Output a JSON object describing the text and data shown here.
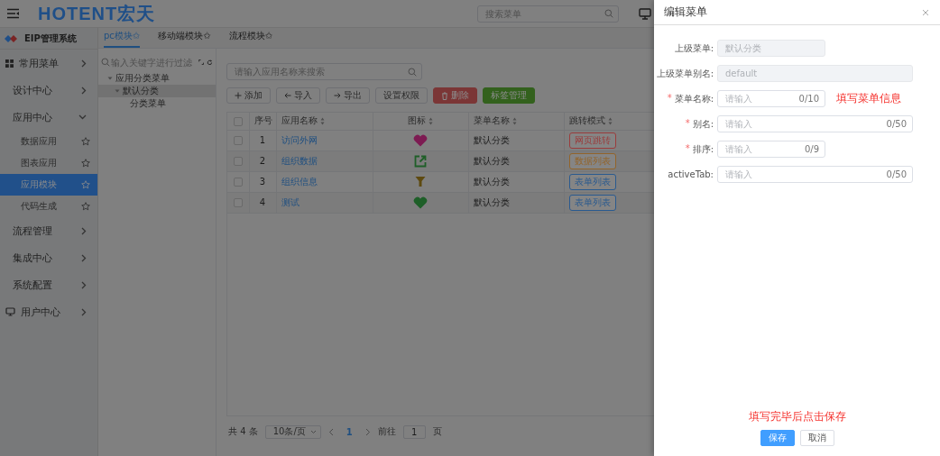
{
  "header": {
    "logo": "HOTENT宏天",
    "search": {
      "placeholder": "搜索菜单"
    }
  },
  "sidebar": {
    "title": "EIP管理系统",
    "items": [
      {
        "label": "常用菜单",
        "kind": "grid",
        "expanded": false
      },
      {
        "label": "设计中心",
        "kind": "plain",
        "expanded": false
      },
      {
        "label": "应用中心",
        "kind": "plain",
        "expanded": true,
        "children": [
          {
            "label": "数据应用",
            "selected": false
          },
          {
            "label": "图表应用",
            "selected": false
          },
          {
            "label": "应用模块",
            "selected": true
          },
          {
            "label": "代码生成",
            "selected": false
          }
        ]
      },
      {
        "label": "流程管理",
        "kind": "plain",
        "expanded": false
      },
      {
        "label": "集成中心",
        "kind": "plain",
        "expanded": false
      },
      {
        "label": "系统配置",
        "kind": "plain",
        "expanded": false
      },
      {
        "label": "用户中心",
        "kind": "monitor",
        "expanded": false
      }
    ]
  },
  "tabs": [
    {
      "label": "pc模块✩",
      "selected": true
    },
    {
      "label": "移动端模块✩",
      "selected": false
    },
    {
      "label": "流程模块✩",
      "selected": false
    }
  ],
  "tree": {
    "filter": {
      "placeholder": "输入关键字进行过滤"
    },
    "nodes": [
      {
        "label": "应用分类菜单",
        "selected": false,
        "expanded": true,
        "children": [
          {
            "label": "默认分类",
            "selected": true,
            "expanded": true,
            "children": [
              {
                "label": "分类菜单",
                "selected": false
              }
            ]
          }
        ]
      }
    ]
  },
  "search": {
    "placeholder": "请输入应用名称来搜索"
  },
  "toolbar": [
    {
      "label": "添加",
      "kind": "add"
    },
    {
      "label": "导入",
      "kind": "import"
    },
    {
      "label": "导出",
      "kind": "export"
    },
    {
      "label": "设置权限",
      "kind": "plain"
    },
    {
      "label": "删除",
      "kind": "danger"
    },
    {
      "label": "标签管理",
      "kind": "success"
    }
  ],
  "table": {
    "select_all": {
      "checked": false
    },
    "columns": [
      {
        "label": "序号",
        "sortable": false
      },
      {
        "label": "应用名称",
        "sortable": true
      },
      {
        "label": "图标",
        "sortable": true
      },
      {
        "label": "菜单名称",
        "sortable": true
      },
      {
        "label": "跳转模式",
        "sortable": true
      }
    ],
    "rows": [
      {
        "checked": false,
        "index": "1",
        "name": "访问外网",
        "icon": {
          "kind": "heart",
          "color": "#7d1b52"
        },
        "menu": "默认分类",
        "mode": {
          "label": "网页跳转",
          "color": "#9a3c3c"
        }
      },
      {
        "checked": false,
        "index": "2",
        "name": "组织数据",
        "icon": {
          "kind": "link",
          "color": "#1f5f28"
        },
        "menu": "默认分类",
        "mode": {
          "label": "数据列表",
          "color": "#93642a"
        }
      },
      {
        "checked": false,
        "index": "3",
        "name": "组织信息",
        "icon": {
          "kind": "filter",
          "color": "#5e4a10"
        },
        "menu": "默认分类",
        "mode": {
          "label": "表单列表",
          "color": "#2a5a8f"
        }
      },
      {
        "checked": false,
        "index": "4",
        "name": "测试",
        "icon": {
          "kind": "heart",
          "color": "#1e5f28"
        },
        "menu": "默认分类",
        "mode": {
          "label": "表单列表",
          "color": "#2a5a8f"
        }
      }
    ]
  },
  "pagination": {
    "total": "共 4 条",
    "page_size": "10条/页",
    "pages": [
      {
        "label": "1",
        "selected": true
      }
    ],
    "goto_label": "前往",
    "goto_value": "1",
    "suffix": "页"
  },
  "drawer": {
    "title": "编辑菜单",
    "fields": [
      {
        "label": "上级菜单:",
        "value": "默认分类",
        "disabled": true,
        "wide": false
      },
      {
        "label": "上级菜单别名:",
        "value": "default",
        "disabled": true,
        "wide": true
      },
      {
        "label": "菜单名称:",
        "required_mark": "*",
        "placeholder": "请输入",
        "counter": "0/10",
        "disabled": false,
        "wide": false,
        "annotation": "填写菜单信息"
      },
      {
        "label": "别名:",
        "required_mark": "*",
        "placeholder": "请输入",
        "counter": "0/50",
        "disabled": false,
        "wide": true
      },
      {
        "label": "排序:",
        "required_mark": "*",
        "placeholder": "请输入",
        "counter": "0/9",
        "disabled": false,
        "wide": false
      },
      {
        "label": "activeTab:",
        "placeholder": "请输入",
        "counter": "0/50",
        "disabled": false,
        "wide": true
      }
    ],
    "annotation": "填写完毕后点击保存",
    "buttons": [
      {
        "label": "保存",
        "kind": "primary"
      },
      {
        "label": "取消",
        "kind": "default"
      }
    ]
  }
}
